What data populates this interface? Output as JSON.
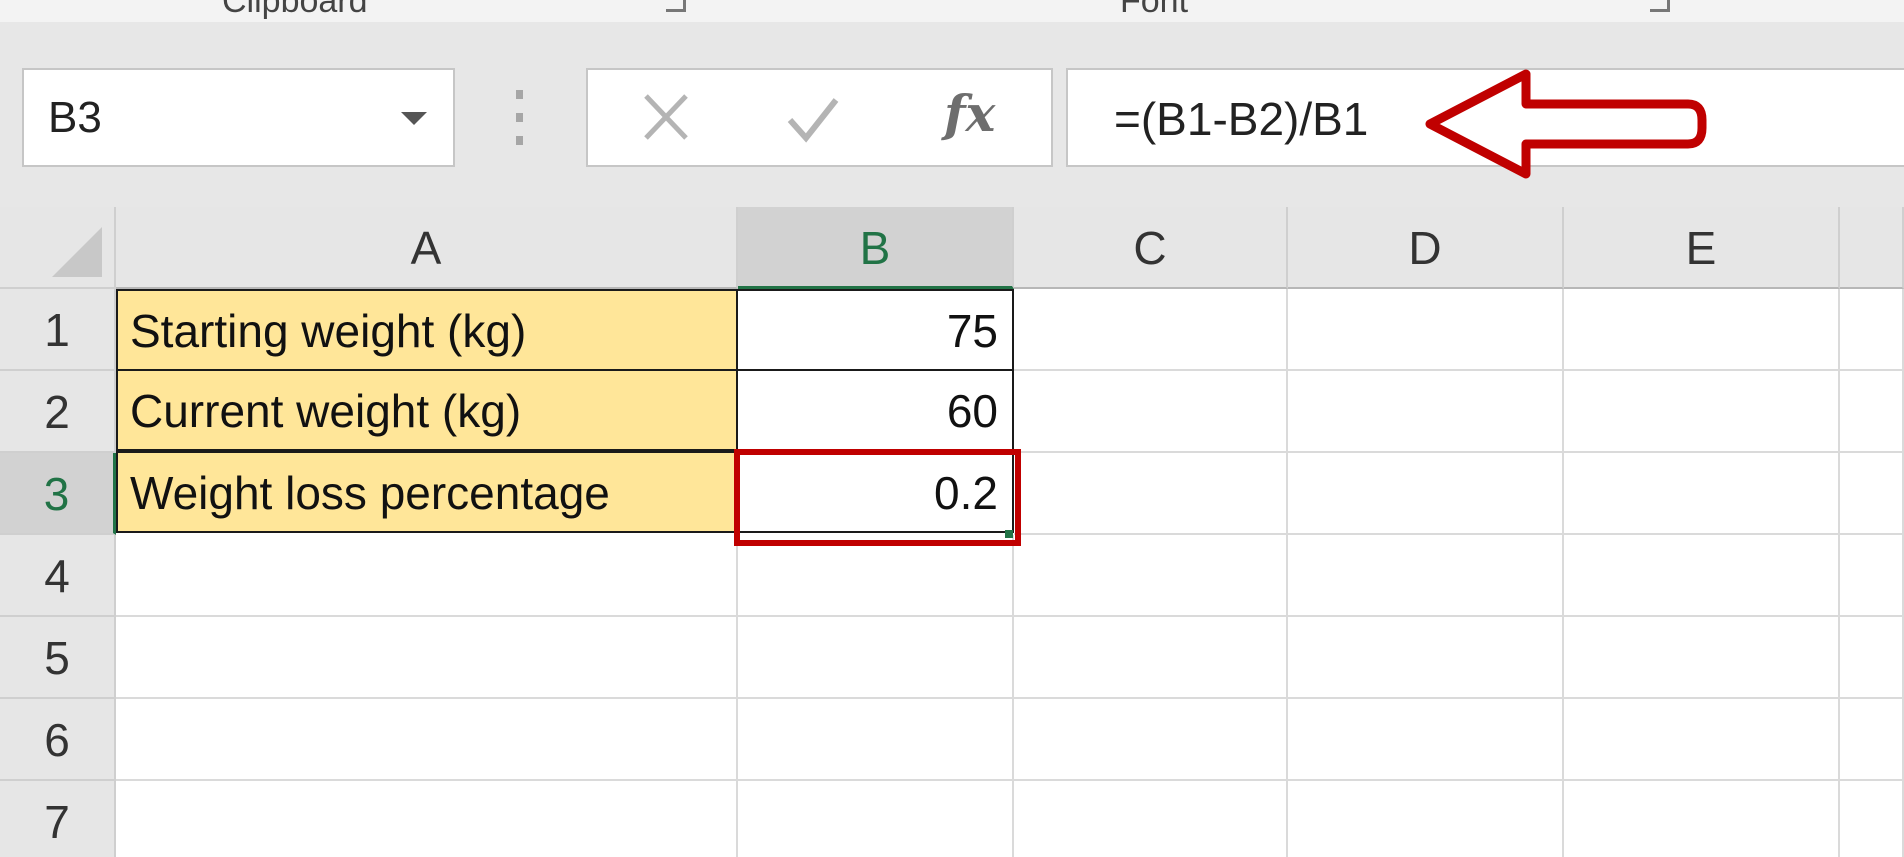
{
  "ribbon": {
    "groups": [
      {
        "label": "Clipboard"
      },
      {
        "label": "Font"
      }
    ]
  },
  "formula_bar": {
    "name_box_value": "B3",
    "formula": "=(B1-B2)/B1",
    "cancel_icon": "x-icon",
    "enter_icon": "check-icon",
    "fx_label": "fx"
  },
  "columns": [
    "A",
    "B",
    "C",
    "D",
    "E"
  ],
  "rows": [
    "1",
    "2",
    "3",
    "4",
    "5",
    "6",
    "7"
  ],
  "active_cell": {
    "column": "B",
    "row": "3"
  },
  "cells": {
    "A1": "Starting weight (kg)",
    "A2": "Current weight (kg)",
    "A3": "Weight loss percentage",
    "B1": "75",
    "B2": "60",
    "B3": "0.2"
  },
  "colors": {
    "label_fill": "#ffe699",
    "highlight": "#c00000",
    "selection_accent": "#217346"
  }
}
